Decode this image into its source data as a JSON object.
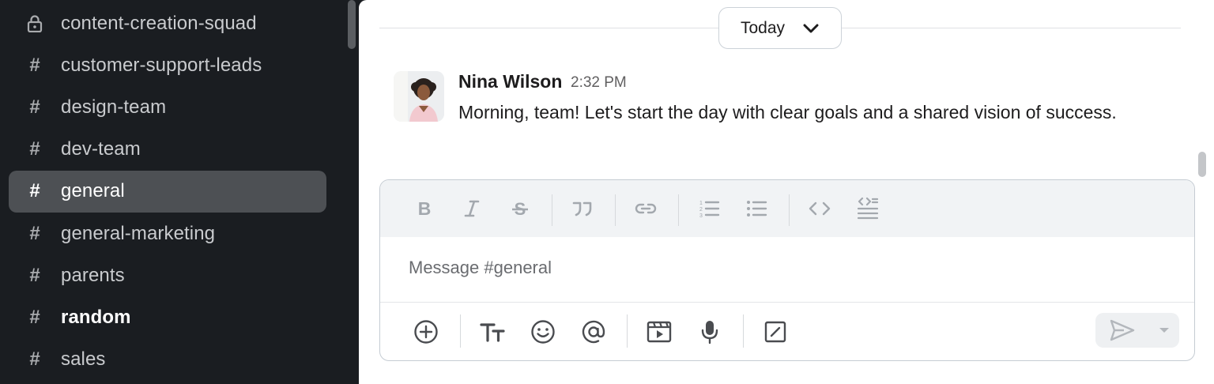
{
  "sidebar": {
    "channels": [
      {
        "label": "content-creation-squad",
        "icon": "lock-icon",
        "active": false,
        "unread": false
      },
      {
        "label": "customer-support-leads",
        "icon": "hash-icon",
        "active": false,
        "unread": false
      },
      {
        "label": "design-team",
        "icon": "hash-icon",
        "active": false,
        "unread": false
      },
      {
        "label": "dev-team",
        "icon": "hash-icon",
        "active": false,
        "unread": false
      },
      {
        "label": "general",
        "icon": "hash-icon",
        "active": true,
        "unread": false
      },
      {
        "label": "general-marketing",
        "icon": "hash-icon",
        "active": false,
        "unread": false
      },
      {
        "label": "parents",
        "icon": "hash-icon",
        "active": false,
        "unread": false
      },
      {
        "label": "random",
        "icon": "hash-icon",
        "active": false,
        "unread": true
      },
      {
        "label": "sales",
        "icon": "hash-icon",
        "active": false,
        "unread": false
      }
    ],
    "hash_glyph": "#"
  },
  "main": {
    "date_divider": {
      "label": "Today",
      "icon": "chevron-down-icon"
    },
    "message": {
      "author": "Nina Wilson",
      "time": "2:32 PM",
      "text": "Morning, team! Let's start the day with clear goals and a shared vision of success."
    }
  },
  "composer": {
    "placeholder": "Message #general",
    "format_buttons": [
      "bold-icon",
      "italic-icon",
      "strikethrough-icon",
      "quote-icon",
      "link-icon",
      "ordered-list-icon",
      "bulleted-list-icon",
      "code-icon",
      "code-block-icon"
    ],
    "action_buttons": [
      "plus-icon",
      "text-format-icon",
      "emoji-icon",
      "mention-icon",
      "video-clip-icon",
      "microphone-icon",
      "shortcut-icon"
    ],
    "send": {
      "icon": "send-icon",
      "options_icon": "caret-down-icon"
    }
  },
  "colors": {
    "sidebar_bg": "#1a1d21",
    "active_channel_bg": "#4d5054",
    "main_bg": "#ffffff",
    "toolbar_bg": "#f1f3f5"
  }
}
